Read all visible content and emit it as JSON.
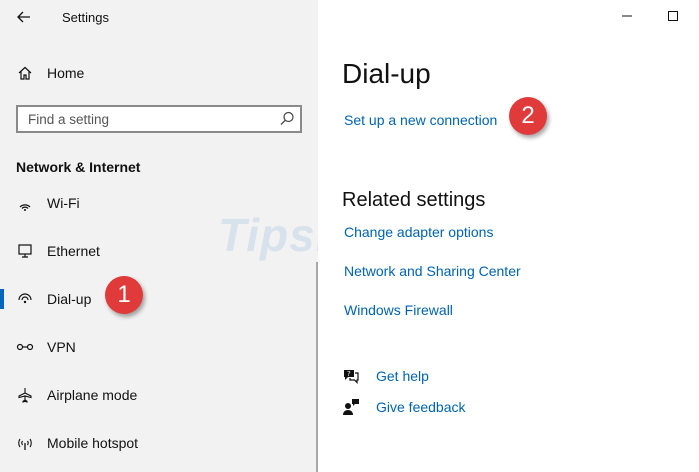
{
  "window": {
    "title": "Settings"
  },
  "sidebar": {
    "home_label": "Home",
    "search_placeholder": "Find a setting",
    "section_label": "Network & Internet",
    "items": [
      {
        "label": "Wi-Fi",
        "icon": "wifi-icon"
      },
      {
        "label": "Ethernet",
        "icon": "ethernet-icon"
      },
      {
        "label": "Dial-up",
        "icon": "dialup-icon",
        "selected": true
      },
      {
        "label": "VPN",
        "icon": "vpn-icon"
      },
      {
        "label": "Airplane mode",
        "icon": "airplane-icon"
      },
      {
        "label": "Mobile hotspot",
        "icon": "hotspot-icon"
      }
    ]
  },
  "main": {
    "title": "Dial-up",
    "setup_link": "Set up a new connection",
    "related_title": "Related settings",
    "related_links": [
      "Change adapter options",
      "Network and Sharing Center",
      "Windows Firewall"
    ],
    "get_help": "Get help",
    "give_feedback": "Give feedback"
  },
  "annotations": {
    "badge1": "1",
    "badge2": "2"
  },
  "watermark": "TipsMake",
  "colors": {
    "accent": "#0067c0",
    "link": "#0063b1",
    "badge": "#e03a3a",
    "sidebar_bg": "#f2f2f2"
  }
}
